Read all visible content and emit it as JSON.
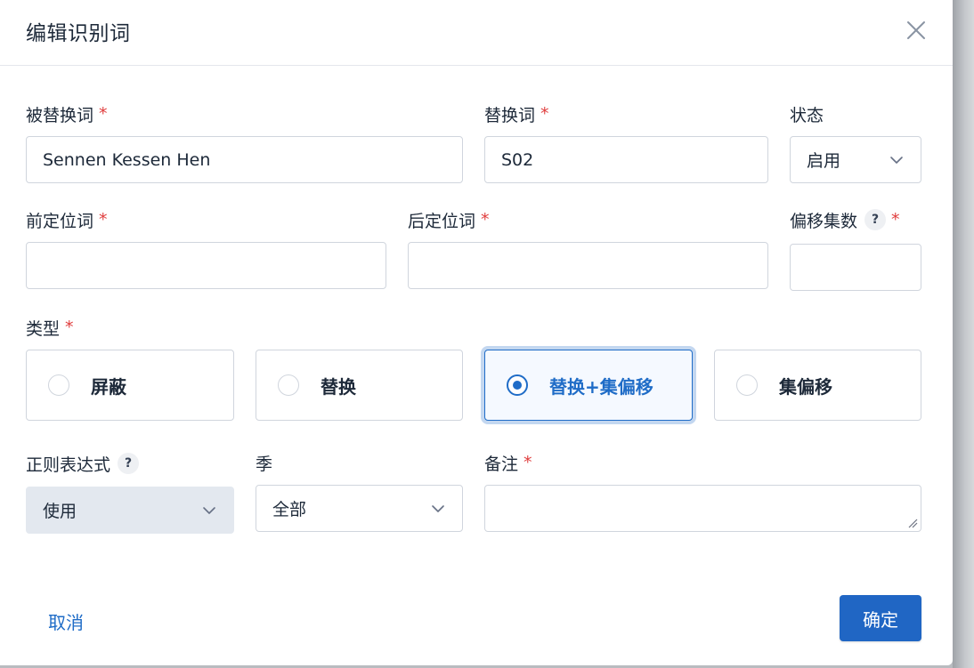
{
  "dialog": {
    "title": "编辑识别词",
    "close_icon": "close-icon"
  },
  "fields": {
    "replaced_word": {
      "label": "被替换词",
      "required": "*",
      "value": "Sennen Kessen Hen"
    },
    "replacement_word": {
      "label": "替换词",
      "required": "*",
      "value": "S02"
    },
    "status": {
      "label": "状态",
      "value": "启用"
    },
    "prefix_locator": {
      "label": "前定位词",
      "required": "*",
      "value": ""
    },
    "suffix_locator": {
      "label": "后定位词",
      "required": "*",
      "value": ""
    },
    "episode_offset": {
      "label": "偏移集数",
      "help": "?",
      "required": "*",
      "value": ""
    },
    "type": {
      "label": "类型",
      "required": "*",
      "options": [
        {
          "label": "屏蔽",
          "selected": false
        },
        {
          "label": "替换",
          "selected": false
        },
        {
          "label": "替换+集偏移",
          "selected": true
        },
        {
          "label": "集偏移",
          "selected": false
        }
      ]
    },
    "regex": {
      "label": "正则表达式",
      "help": "?",
      "value": "使用"
    },
    "season": {
      "label": "季",
      "value": "全部"
    },
    "remark": {
      "label": "备注",
      "required": "*",
      "value": ""
    }
  },
  "footer": {
    "cancel_label": "取消",
    "confirm_label": "确定"
  },
  "colors": {
    "accent": "#2066c4",
    "required": "#e03e3e",
    "selected_card_bg": "#f5f9ff"
  }
}
